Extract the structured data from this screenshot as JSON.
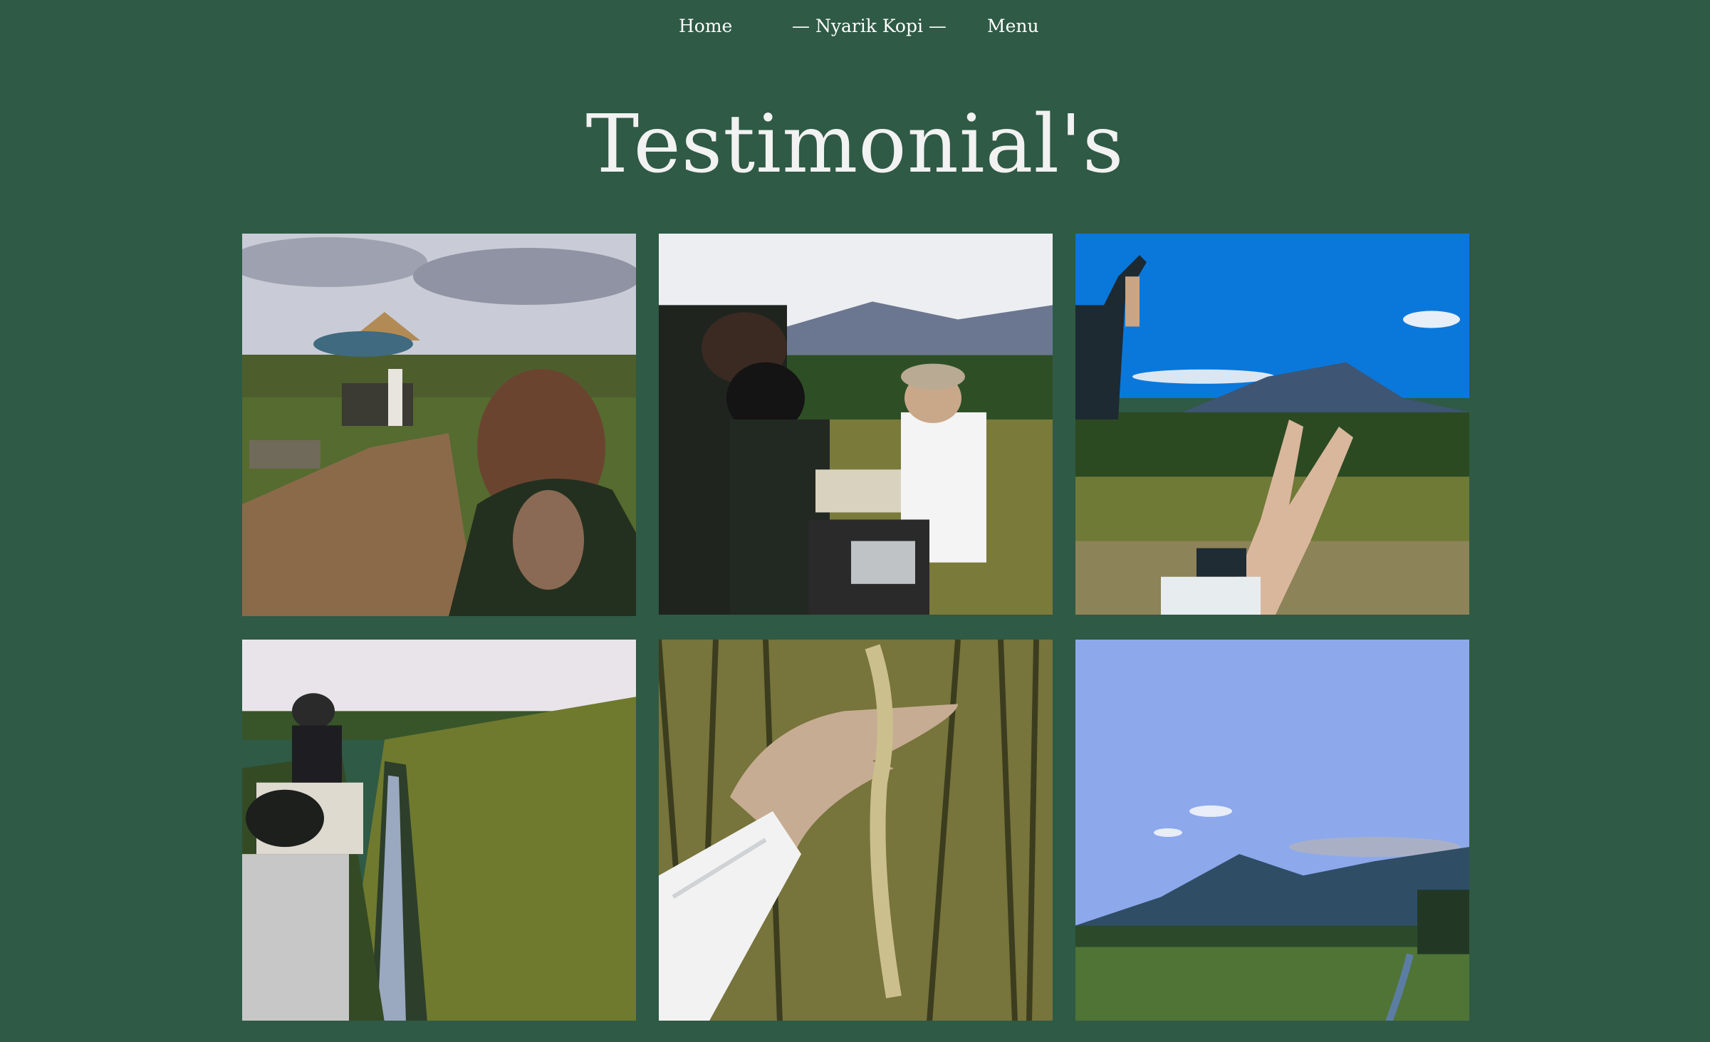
{
  "nav": {
    "home_label": "Home",
    "brand_label": "— Nyarik Kopi —",
    "menu_label": "Menu"
  },
  "page": {
    "title": "Testimonial's"
  },
  "gallery": {
    "photos": [
      {
        "subject": "dirt road with coffee stall, umbrella and person with long hair in foreground"
      },
      {
        "subject": "people gathered around a motorbike in front of mountains"
      },
      {
        "subject": "hands making peace signs over rice fields and mountain"
      },
      {
        "subject": "people sitting on woven mats beside an irrigation canal and rice field"
      },
      {
        "subject": "hand holding rice stalks"
      },
      {
        "subject": "blue sky over mountain and green rice fields"
      }
    ]
  },
  "colors": {
    "background": "#2f5a45",
    "text": "#ffffff"
  }
}
